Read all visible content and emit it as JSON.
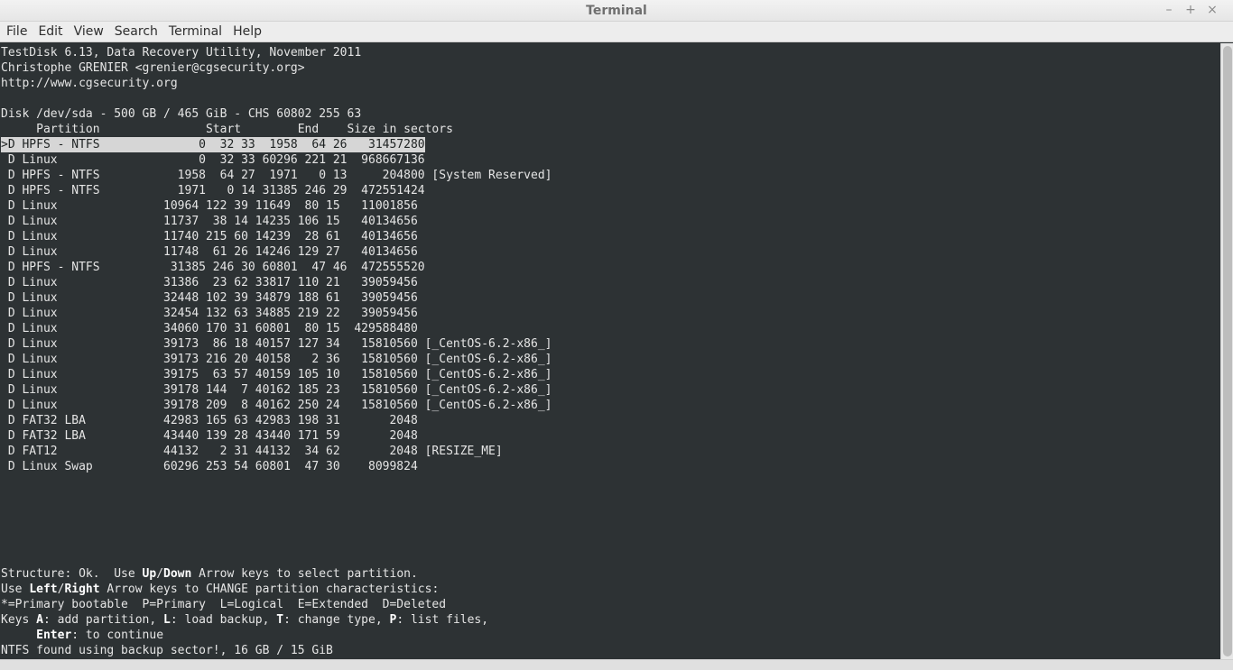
{
  "window": {
    "title": "Terminal",
    "controls": [
      "–",
      "+",
      "×"
    ]
  },
  "menu": [
    "File",
    "Edit",
    "View",
    "Search",
    "Terminal",
    "Help"
  ],
  "terminal": {
    "header": [
      "TestDisk 6.13, Data Recovery Utility, November 2011",
      "Christophe GRENIER <grenier@cgsecurity.org>",
      "http://www.cgsecurity.org"
    ],
    "disk_line": "Disk /dev/sda - 500 GB / 465 GiB - CHS 60802 255 63",
    "columns_line": "     Partition               Start        End    Size in sectors",
    "selected_row": 0,
    "partitions": [
      ">D HPFS - NTFS              0  32 33  1958  64 26   31457280",
      " D Linux                    0  32 33 60296 221 21  968667136",
      " D HPFS - NTFS           1958  64 27  1971   0 13     204800 [System Reserved]",
      " D HPFS - NTFS           1971   0 14 31385 246 29  472551424",
      " D Linux               10964 122 39 11649  80 15   11001856",
      " D Linux               11737  38 14 14235 106 15   40134656",
      " D Linux               11740 215 60 14239  28 61   40134656",
      " D Linux               11748  61 26 14246 129 27   40134656",
      " D HPFS - NTFS          31385 246 30 60801  47 46  472555520",
      " D Linux               31386  23 62 33817 110 21   39059456",
      " D Linux               32448 102 39 34879 188 61   39059456",
      " D Linux               32454 132 63 34885 219 22   39059456",
      " D Linux               34060 170 31 60801  80 15  429588480",
      " D Linux               39173  86 18 40157 127 34   15810560 [_CentOS-6.2-x86_]",
      " D Linux               39173 216 20 40158   2 36   15810560 [_CentOS-6.2-x86_]",
      " D Linux               39175  63 57 40159 105 10   15810560 [_CentOS-6.2-x86_]",
      " D Linux               39178 144  7 40162 185 23   15810560 [_CentOS-6.2-x86_]",
      " D Linux               39178 209  8 40162 250 24   15810560 [_CentOS-6.2-x86_]",
      " D FAT32 LBA           42983 165 63 42983 198 31       2048",
      " D FAT32 LBA           43440 139 28 43440 171 59       2048",
      " D FAT12               44132   2 31 44132  34 62       2048 [RESIZE_ME]",
      " D Linux Swap          60296 253 54 60801  47 30    8099824"
    ],
    "footer": {
      "l1_a": "Structure: Ok.  Use ",
      "l1_k1": "Up",
      "l1_s": "/",
      "l1_k2": "Down",
      "l1_b": " Arrow keys to select partition.",
      "l2_a": "Use ",
      "l2_k1": "Left",
      "l2_s": "/",
      "l2_k2": "Right",
      "l2_b": " Arrow keys to CHANGE partition characteristics:",
      "l3": "*=Primary bootable  P=Primary  L=Logical  E=Extended  D=Deleted",
      "l4_a": "Keys ",
      "l4_k1": "A",
      "l4_b": ": add partition, ",
      "l4_k2": "L",
      "l4_c": ": load backup, ",
      "l4_k3": "T",
      "l4_d": ": change type, ",
      "l4_k4": "P",
      "l4_e": ": list files,",
      "l5_a": "     ",
      "l5_k1": "Enter",
      "l5_b": ": to continue",
      "l6": "NTFS found using backup sector!, 16 GB / 15 GiB"
    }
  }
}
